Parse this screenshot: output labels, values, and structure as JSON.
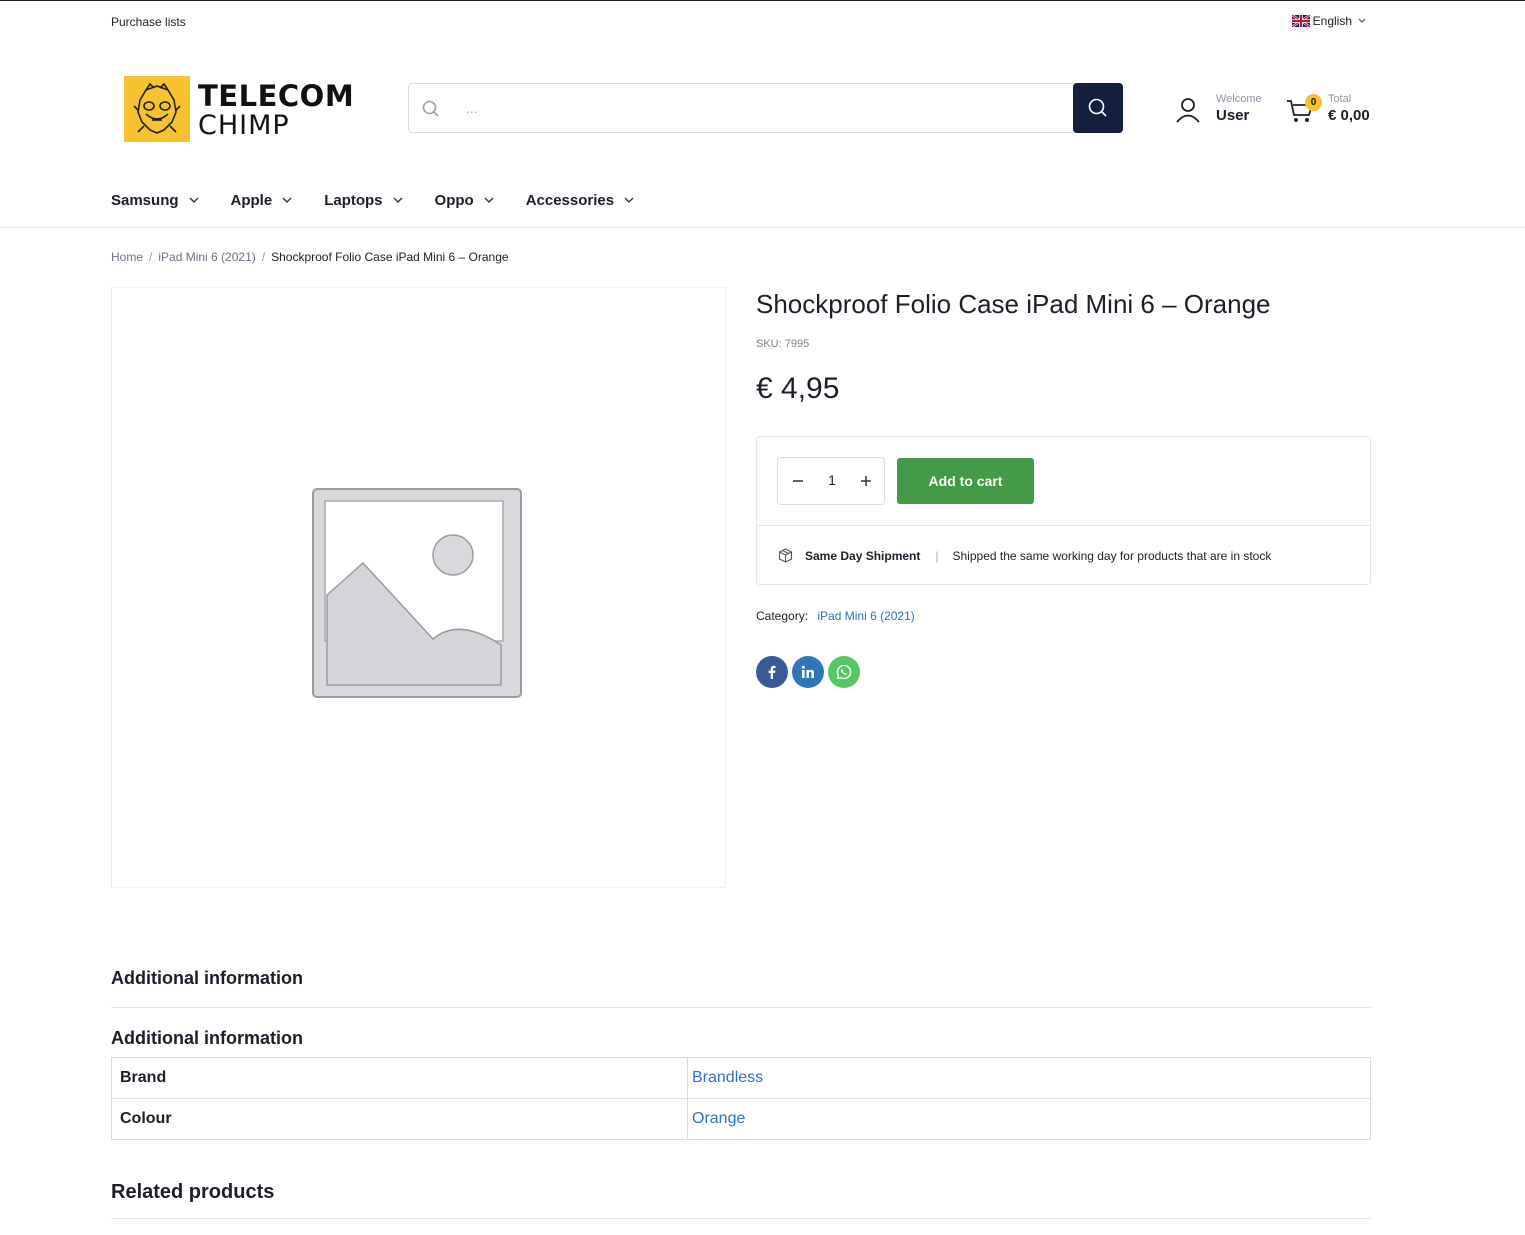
{
  "topbar": {
    "purchase_lists": "Purchase lists",
    "language": "English"
  },
  "brand": {
    "line1": "TELECOM",
    "line2": "CHIMP",
    "logo_color": "#f6c230"
  },
  "search": {
    "placeholder": "..."
  },
  "account": {
    "label": "Welcome",
    "name": "User"
  },
  "cart": {
    "count": "0",
    "label": "Total",
    "total": "€ 0,00"
  },
  "nav": {
    "items": [
      {
        "label": "Samsung"
      },
      {
        "label": "Apple"
      },
      {
        "label": "Laptops"
      },
      {
        "label": "Oppo"
      },
      {
        "label": "Accessories"
      }
    ]
  },
  "breadcrumb": {
    "home": "Home",
    "sep": "/",
    "category": "iPad Mini 6 (2021)",
    "current": "Shockproof Folio Case iPad Mini 6 – Orange"
  },
  "product": {
    "title": "Shockproof Folio Case iPad Mini 6 – Orange",
    "sku": "SKU: 7995",
    "price": "€ 4,95",
    "quantity": "1",
    "add_to_cart": "Add to cart",
    "shipment_title": "Same Day Shipment",
    "shipment_sep": "|",
    "shipment_desc": "Shipped the same working day for products that are in stock",
    "category_label": "Category:",
    "category_value": "iPad Mini 6 (2021)",
    "accent_color": "#439b47"
  },
  "additional_info": {
    "tab_label": "Additional information",
    "heading": "Additional information",
    "rows": [
      {
        "key": "Brand",
        "value": "Brandless"
      },
      {
        "key": "Colour",
        "value": "Orange"
      }
    ]
  },
  "related": {
    "heading": "Related products"
  }
}
